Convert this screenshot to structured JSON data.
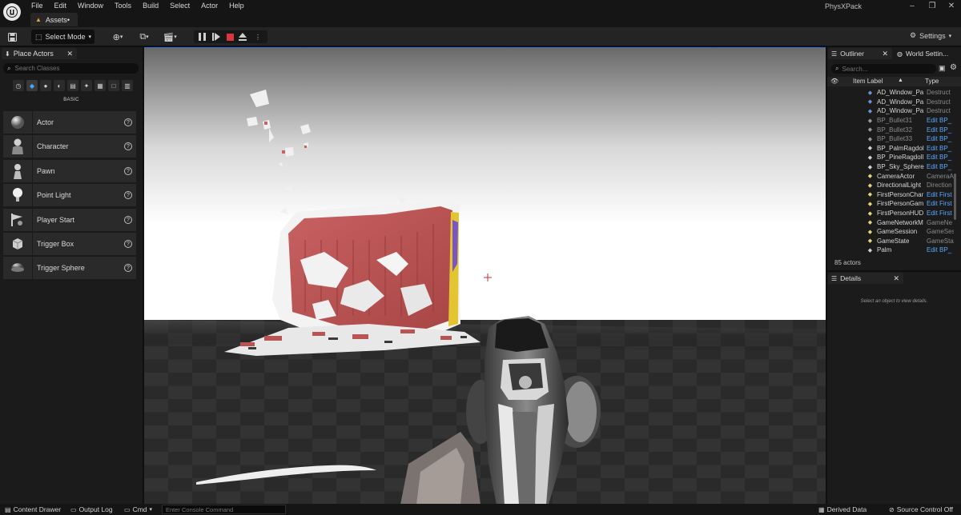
{
  "titlebar": {
    "menu": [
      "File",
      "Edit",
      "Window",
      "Tools",
      "Build",
      "Select",
      "Actor",
      "Help"
    ],
    "tab": "Assets•",
    "project": "PhysXPack"
  },
  "toolbar": {
    "select_mode": "Select Mode",
    "settings": "Settings"
  },
  "place_actors": {
    "tab": "Place Actors",
    "search_placeholder": "Search Classes",
    "category": "BASIC",
    "items": [
      {
        "label": "Actor",
        "icon": "sphere-icon"
      },
      {
        "label": "Character",
        "icon": "character-icon"
      },
      {
        "label": "Pawn",
        "icon": "pawn-icon"
      },
      {
        "label": "Point Light",
        "icon": "point-light-icon"
      },
      {
        "label": "Player Start",
        "icon": "player-start-icon"
      },
      {
        "label": "Trigger Box",
        "icon": "trigger-box-icon"
      },
      {
        "label": "Trigger Sphere",
        "icon": "trigger-sphere-icon"
      }
    ]
  },
  "outliner": {
    "tab": "Outliner",
    "world_tab": "World Settin...",
    "search_placeholder": "Search...",
    "col_label": "Item Label",
    "col_type": "Type",
    "rows": [
      {
        "name": "AD_Window_Pa",
        "type": "Destruct",
        "link": false,
        "dim": false,
        "icon": "#6f8fd8"
      },
      {
        "name": "AD_Window_Pa",
        "type": "Destruct",
        "link": false,
        "dim": false,
        "icon": "#6f8fd8"
      },
      {
        "name": "AD_Window_Pa",
        "type": "Destruct",
        "link": false,
        "dim": false,
        "icon": "#6f8fd8"
      },
      {
        "name": "BP_Bullet31",
        "type": "Edit BP_",
        "link": true,
        "dim": true,
        "icon": "#9a9a9a"
      },
      {
        "name": "BP_Bullet32",
        "type": "Edit BP_",
        "link": true,
        "dim": true,
        "icon": "#9a9a9a"
      },
      {
        "name": "BP_Bullet33",
        "type": "Edit BP_",
        "link": true,
        "dim": true,
        "icon": "#9a9a9a"
      },
      {
        "name": "BP_PalmRagdol",
        "type": "Edit BP_",
        "link": true,
        "dim": false,
        "icon": "#cfcfcf"
      },
      {
        "name": "BP_PineRagdoll",
        "type": "Edit BP_",
        "link": true,
        "dim": false,
        "icon": "#cfcfcf"
      },
      {
        "name": "BP_Sky_Sphere",
        "type": "Edit BP_",
        "link": true,
        "dim": false,
        "icon": "#cfcfcf"
      },
      {
        "name": "CameraActor",
        "type": "CameraA",
        "link": false,
        "dim": false,
        "icon": "#e8d27a"
      },
      {
        "name": "DirectionalLight",
        "type": "Direction",
        "link": false,
        "dim": false,
        "icon": "#e8d27a"
      },
      {
        "name": "FirstPersonChar",
        "type": "Edit First",
        "link": true,
        "dim": false,
        "icon": "#e8d27a"
      },
      {
        "name": "FirstPersonGam",
        "type": "Edit First",
        "link": true,
        "dim": false,
        "icon": "#e8d27a"
      },
      {
        "name": "FirstPersonHUD",
        "type": "Edit First",
        "link": true,
        "dim": false,
        "icon": "#e8d27a"
      },
      {
        "name": "GameNetworkM",
        "type": "GameNe",
        "link": false,
        "dim": false,
        "icon": "#e8d27a"
      },
      {
        "name": "GameSession",
        "type": "GameSes",
        "link": false,
        "dim": false,
        "icon": "#e8d27a"
      },
      {
        "name": "GameState",
        "type": "GameSta",
        "link": false,
        "dim": false,
        "icon": "#e8d27a"
      },
      {
        "name": "Palm",
        "type": "Edit BP_",
        "link": true,
        "dim": false,
        "icon": "#cfcfcf"
      }
    ],
    "count": "85 actors"
  },
  "details": {
    "tab": "Details",
    "hint": "Select an object to view details."
  },
  "statusbar": {
    "content_drawer": "Content Drawer",
    "output_log": "Output Log",
    "cmd": "Cmd",
    "console_placeholder": "Enter Console Command",
    "derived_data": "Derived Data",
    "source_control": "Source Control Off"
  },
  "colors": {
    "accent_blue": "#2a6cd6",
    "link_blue": "#5aa8ff",
    "stop_red": "#d9363e",
    "panel_bg": "#1b1b1b"
  }
}
